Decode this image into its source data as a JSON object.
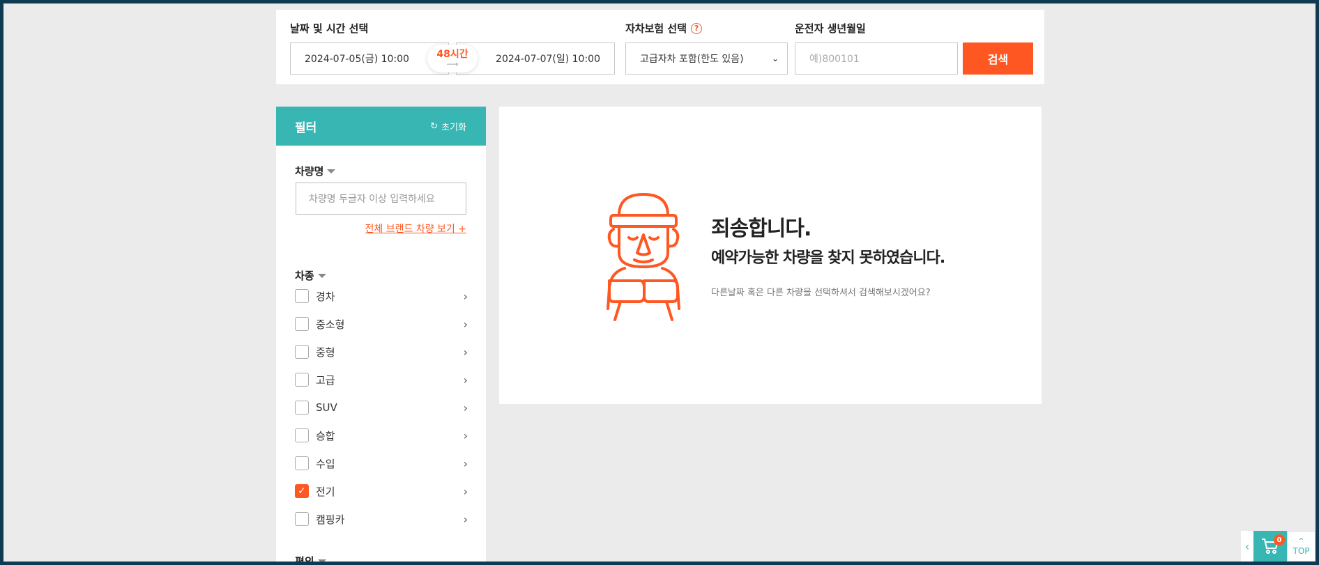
{
  "search": {
    "date_label": "날짜 및 시간 선택",
    "start": "2024-07-05(금) 10:00",
    "end": "2024-07-07(일) 10:00",
    "duration": "48시간",
    "insurance_label": "자차보험 선택",
    "insurance_value": "고급자차 포함(한도 있음)",
    "birth_label": "운전자 생년월일",
    "birth_placeholder": "예)800101",
    "search_label": "검색"
  },
  "filter": {
    "title": "필터",
    "reset_label": "초기화",
    "name_section": "차량명",
    "name_placeholder": "차량명 두글자 이상 입력하세요",
    "all_brands": "전체 브랜드 차량 보기 +",
    "type_section": "차종",
    "types": [
      {
        "label": "경차",
        "checked": false
      },
      {
        "label": "중소형",
        "checked": false
      },
      {
        "label": "중형",
        "checked": false
      },
      {
        "label": "고급",
        "checked": false
      },
      {
        "label": "SUV",
        "checked": false
      },
      {
        "label": "승합",
        "checked": false
      },
      {
        "label": "수입",
        "checked": false
      },
      {
        "label": "전기",
        "checked": true
      },
      {
        "label": "캠핑카",
        "checked": false
      }
    ],
    "option_section": "편의"
  },
  "result": {
    "title": "죄송합니다.",
    "subtitle": "예약가능한 차량을 찾지 못하였습니다.",
    "hint": "다른날짜 혹은 다른 차량을 선택하셔서 검색해보시겠어요?"
  },
  "floating": {
    "cart_count": "0",
    "top_label": "TOP"
  },
  "colors": {
    "accent": "#ff5722",
    "teal": "#38b6b4"
  }
}
